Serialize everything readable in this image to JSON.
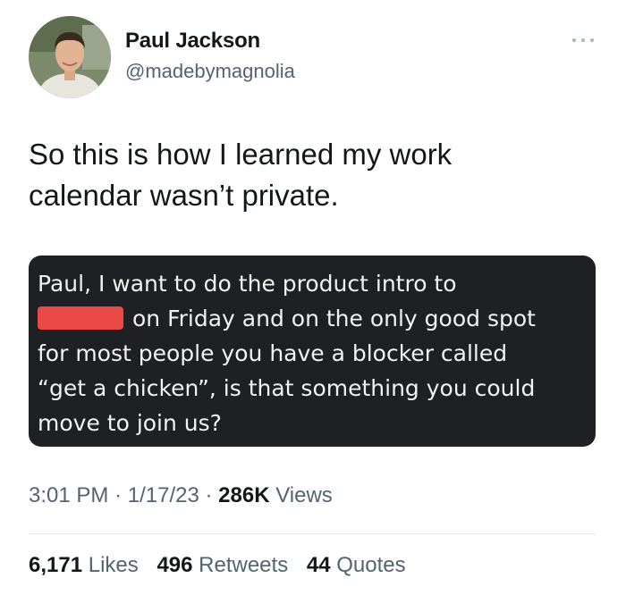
{
  "author": {
    "name": "Paul Jackson",
    "handle": "@madebymagnolia"
  },
  "menu_icon": "more-horizontal-icon",
  "tweet": {
    "line1": "So this is how I learned my work",
    "line2": "calendar wasn’t private."
  },
  "quoted_message": {
    "line1": "Paul, I want to do the product intro to",
    "line2_after_redaction": "on Friday and on the only good spot",
    "line3": "for most people you have a blocker called",
    "line4": "“get a chicken”, is that something you could",
    "line5": "move to join us?",
    "redaction_color": "#e94a45"
  },
  "meta": {
    "time": "3:01 PM",
    "date": "1/17/23",
    "views_count": "286K",
    "views_label": "Views",
    "separator": "·"
  },
  "stats": {
    "likes_count": "6,171",
    "likes_label": "Likes",
    "retweets_count": "496",
    "retweets_label": "Retweets",
    "quotes_count": "44",
    "quotes_label": "Quotes"
  },
  "colors": {
    "text_primary": "#14171a",
    "text_secondary": "#536471",
    "quote_background": "#1f2023"
  }
}
